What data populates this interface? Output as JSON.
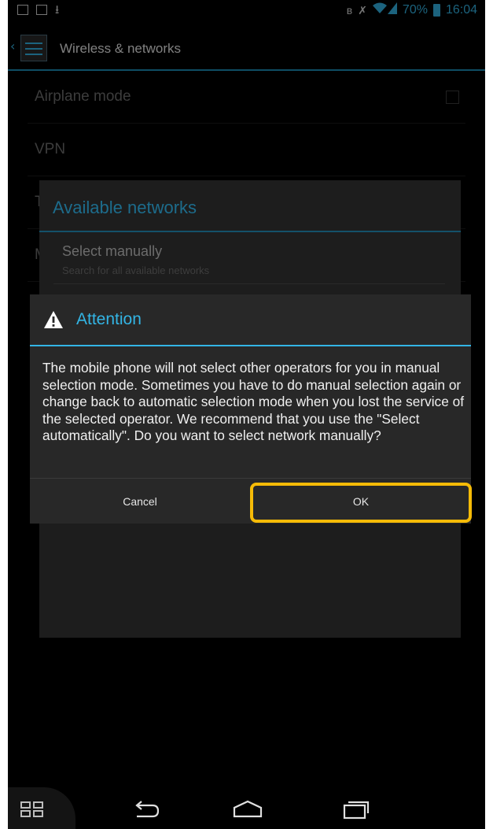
{
  "status_bar": {
    "left_icons": [
      "mail-icon",
      "image-icon",
      "download-icon"
    ],
    "right_icons": [
      "bluetooth-icon",
      "mute-icon",
      "wifi-icon",
      "signal-icon",
      "battery-icon"
    ],
    "battery": "70%",
    "time": "16:04"
  },
  "action_bar": {
    "title": "Wireless & networks"
  },
  "settings_list": {
    "items": [
      {
        "label": "Airplane mode"
      },
      {
        "label": "VPN"
      },
      {
        "label": "T"
      },
      {
        "label": "M"
      }
    ]
  },
  "available_networks_dialog": {
    "title": "Available networks",
    "option_title": "Select manually",
    "option_subtitle": "Search for all available networks"
  },
  "attention_dialog": {
    "title": "Attention",
    "message": "The mobile phone will not select other operators for you in manual selection mode. Sometimes you have to do manual selection again or change back to automatic selection mode when you lost the service of the selected operator. We recommend that you use the \"Select automatically\". Do you want to select network manually?",
    "cancel_label": "Cancel",
    "ok_label": "OK"
  },
  "colors": {
    "accent": "#33b5e5",
    "highlight": "#f6bb07",
    "dialog_bg": "#282828"
  },
  "nav_bar": {
    "icons": [
      "screenshot-icon",
      "back-icon",
      "home-icon",
      "recent-apps-icon"
    ]
  }
}
